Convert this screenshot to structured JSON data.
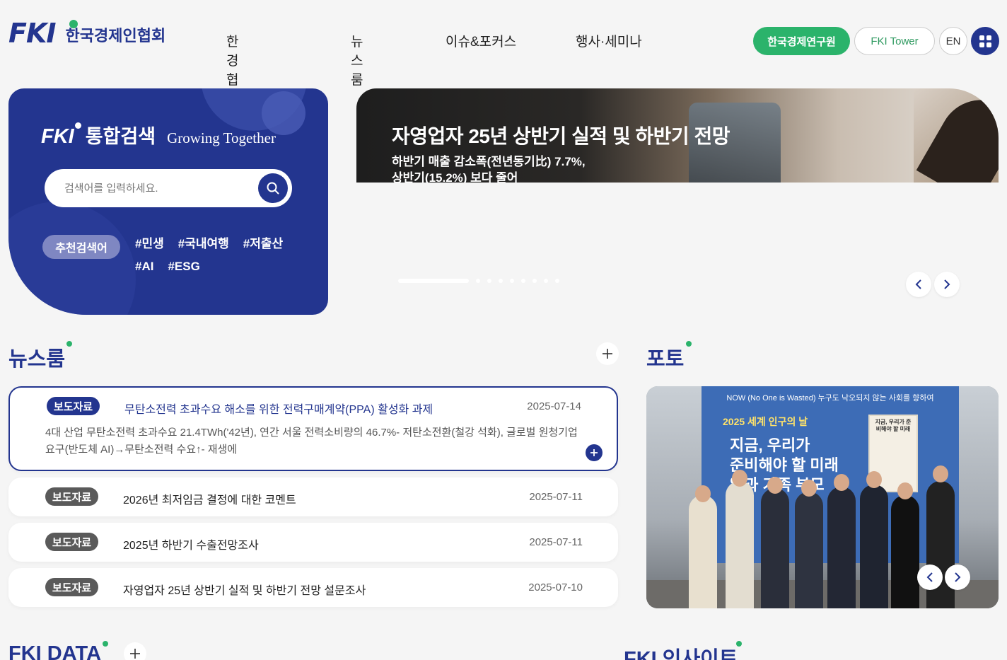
{
  "header": {
    "logo_mark": "FKI",
    "logo_text": "한국경제인협회",
    "nav": [
      "한경협 소개",
      "뉴스룸",
      "이슈&포커스",
      "행사·세미나"
    ],
    "btn_kei": "한국경제연구원",
    "btn_tower": "FKI Tower",
    "btn_lang": "EN"
  },
  "search": {
    "brand": "FKI",
    "title": "통합검색",
    "slogan": "Growing Together",
    "placeholder": "검색어를 입력하세요.",
    "rec_label": "추천검색어",
    "tags": [
      "#민생",
      "#국내여행",
      "#저출산",
      "#AI",
      "#ESG"
    ]
  },
  "banner": {
    "title": "자영업자 25년 상반기 실적 및 하반기 전망",
    "sub1": "하반기 매출 감소폭(전년동기比) 7.7%,",
    "sub2": "상반기(15.2%) 보다 줄어"
  },
  "newsroom": {
    "title": "뉴스룸",
    "items": [
      {
        "badge": "보도자료",
        "title": "무탄소전력 초과수요 해소를 위한 전력구매계약(PPA) 활성화 과제",
        "date": "2025-07-14",
        "body": "4대 산업 무탄소전력 초과수요 21.4TWh('42년), 연간 서울 전력소비량의 46.7%- 저탄소전환(철강 석화), 글로벌 원청기업 요구(반도체 AI)→무탄소전력 수요↑- 재생에"
      },
      {
        "badge": "보도자료",
        "title": "2026년 최저임금 결정에 대한 코멘트",
        "date": "2025-07-11"
      },
      {
        "badge": "보도자료",
        "title": "2025년 하반기 수출전망조사",
        "date": "2025-07-11"
      },
      {
        "badge": "보도자료",
        "title": "자영업자 25년 상반기 실적 및 하반기 전망 설문조사",
        "date": "2025-07-10"
      }
    ]
  },
  "photo": {
    "title": "포토",
    "banner_top": "NOW (No One is Wasted) 누구도 낙오되지 않는 사회를 향하여",
    "banner_h": "2025 세계 인구의 날",
    "banner_big1": "지금, 우리가",
    "banner_big2": "준비해야 할 미래",
    "banner_big3": "일과 가족 부모",
    "book_title": "지금, 우리가 준비해야 할 미래"
  },
  "bottom": {
    "fki_data": "FKI DATA",
    "fki_insight": "FKI 인사이트"
  },
  "colors": {
    "brand": "#23358f",
    "accent": "#2bb36b"
  }
}
